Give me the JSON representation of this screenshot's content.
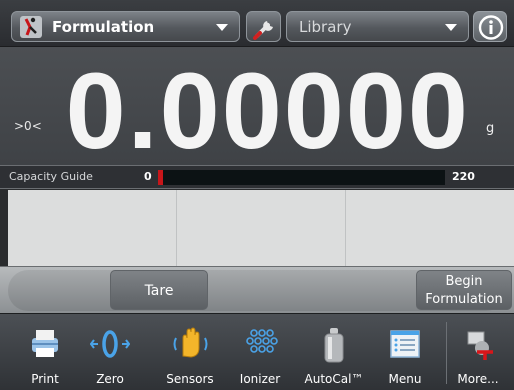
{
  "topbar": {
    "app_dropdown": {
      "label": "Formulation",
      "icon": "formulation-icon"
    },
    "wrench_icon": "wrench-icon",
    "library_dropdown": {
      "label": "Library"
    },
    "info_icon": "info-icon"
  },
  "display": {
    "gtz_indicator": ">0<",
    "weight": "0.00000",
    "unit": "g"
  },
  "capacity_guide": {
    "label": "Capacity Guide",
    "min": "0",
    "max": "220",
    "fill_fraction": 0.0
  },
  "actions": {
    "tare_label": "Tare",
    "begin_line1": "Begin",
    "begin_line2": "Formulation"
  },
  "nav": [
    {
      "label": "Print",
      "icon": "printer-icon"
    },
    {
      "label": "Zero",
      "icon": "zero-icon"
    },
    {
      "label": "Sensors",
      "icon": "hand-sensor-icon"
    },
    {
      "label": "Ionizer",
      "icon": "ionizer-icon"
    },
    {
      "label": "AutoCal™",
      "icon": "calibration-weight-icon"
    },
    {
      "label": "Menu",
      "icon": "menu-icon"
    },
    {
      "label": "More...",
      "icon": "more-icon"
    }
  ]
}
